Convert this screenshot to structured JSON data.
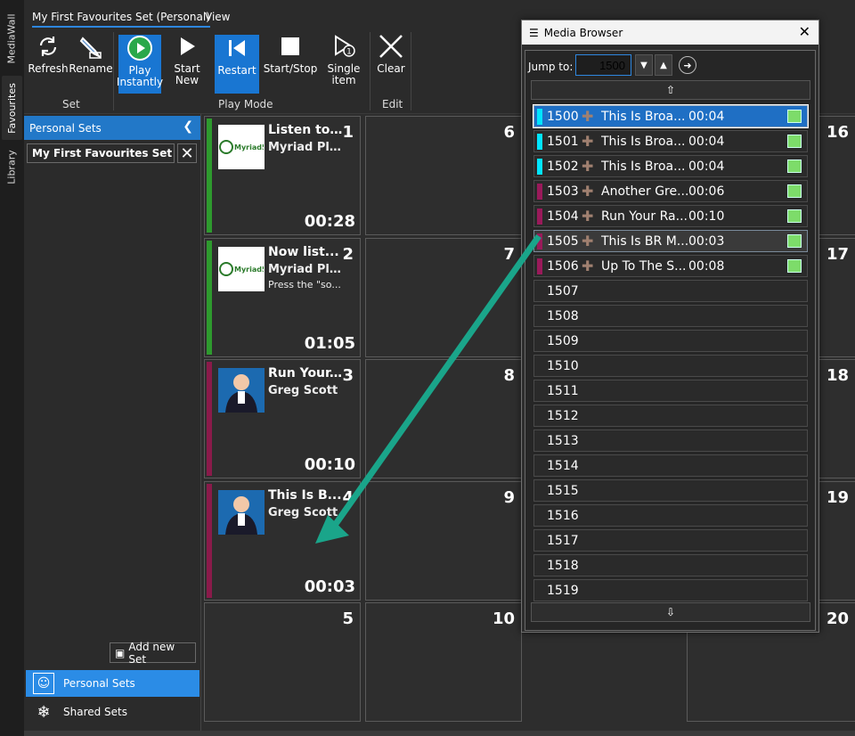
{
  "vtabs": [
    "MediaWall",
    "Favourites",
    "Library"
  ],
  "ribbon": {
    "tabs": [
      "My First Favourites Set (Personal)",
      "View"
    ],
    "buttons": [
      {
        "label1": "Refresh",
        "label2": ""
      },
      {
        "label1": "Rename",
        "label2": ""
      },
      {
        "label1": "Play",
        "label2": "Instantly"
      },
      {
        "label1": "Start",
        "label2": "New"
      },
      {
        "label1": "Restart",
        "label2": ""
      },
      {
        "label1": "Start/Stop",
        "label2": ""
      },
      {
        "label1": "Single",
        "label2": "item"
      },
      {
        "label1": "Clear",
        "label2": ""
      }
    ],
    "groups": [
      "Set",
      "Play Mode",
      "Edit"
    ]
  },
  "left": {
    "header": "Personal Sets",
    "set_name": "My First Favourites Set",
    "add_label": "Add new Set",
    "nav": [
      "Personal Sets",
      "Shared Sets"
    ]
  },
  "cells": [
    {
      "num": "1",
      "t1": "Listen to...",
      "t2": "Myriad Pla...",
      "t3": "",
      "dur": "00:28",
      "bar": "#2e9a2e",
      "thumb": "myriad"
    },
    {
      "num": "2",
      "t1": "Now list...",
      "t2": "Myriad Pla...",
      "t3": "Press the \"so...",
      "dur": "01:05",
      "bar": "#2e9a2e",
      "thumb": "myriad"
    },
    {
      "num": "3",
      "t1": "Run Your...",
      "t2": "Greg Scott",
      "t3": "",
      "dur": "00:10",
      "bar": "#8a1a4a",
      "thumb": "person"
    },
    {
      "num": "4",
      "t1": "This Is B...",
      "t2": "Greg Scott",
      "t3": "",
      "dur": "00:03",
      "bar": "#8a1a4a",
      "thumb": "person"
    },
    {
      "num": "5"
    },
    {
      "num": "6"
    },
    {
      "num": "7"
    },
    {
      "num": "8"
    },
    {
      "num": "9"
    },
    {
      "num": "10"
    },
    {
      "num": "16"
    },
    {
      "num": "17"
    },
    {
      "num": "18"
    },
    {
      "num": "19"
    },
    {
      "num": "20"
    }
  ],
  "media_browser": {
    "title": "Media Browser",
    "jump_label": "Jump to:",
    "jump_value": "1500",
    "rows": [
      {
        "n": "1500",
        "t": "This Is Broa...",
        "d": "00:04",
        "c": "#00e5ff",
        "full": true
      },
      {
        "n": "1501",
        "t": "This Is Broa...",
        "d": "00:04",
        "c": "#00e5ff",
        "full": true
      },
      {
        "n": "1502",
        "t": "This Is Broa...",
        "d": "00:04",
        "c": "#00e5ff",
        "full": true
      },
      {
        "n": "1503",
        "t": "Another Gre...",
        "d": "00:06",
        "c": "#9a1a5a",
        "full": true
      },
      {
        "n": "1504",
        "t": "Run Your Ra...",
        "d": "00:10",
        "c": "#9a1a5a",
        "full": true
      },
      {
        "n": "1505",
        "t": "This Is BR M...",
        "d": "00:03",
        "c": "#9a1a5a",
        "full": true
      },
      {
        "n": "1506",
        "t": "Up To The S...",
        "d": "00:08",
        "c": "#9a1a5a",
        "full": true
      },
      {
        "n": "1507"
      },
      {
        "n": "1508"
      },
      {
        "n": "1509"
      },
      {
        "n": "1510"
      },
      {
        "n": "1511"
      },
      {
        "n": "1512"
      },
      {
        "n": "1513"
      },
      {
        "n": "1514"
      },
      {
        "n": "1515"
      },
      {
        "n": "1516"
      },
      {
        "n": "1517"
      },
      {
        "n": "1518"
      },
      {
        "n": "1519"
      }
    ]
  }
}
